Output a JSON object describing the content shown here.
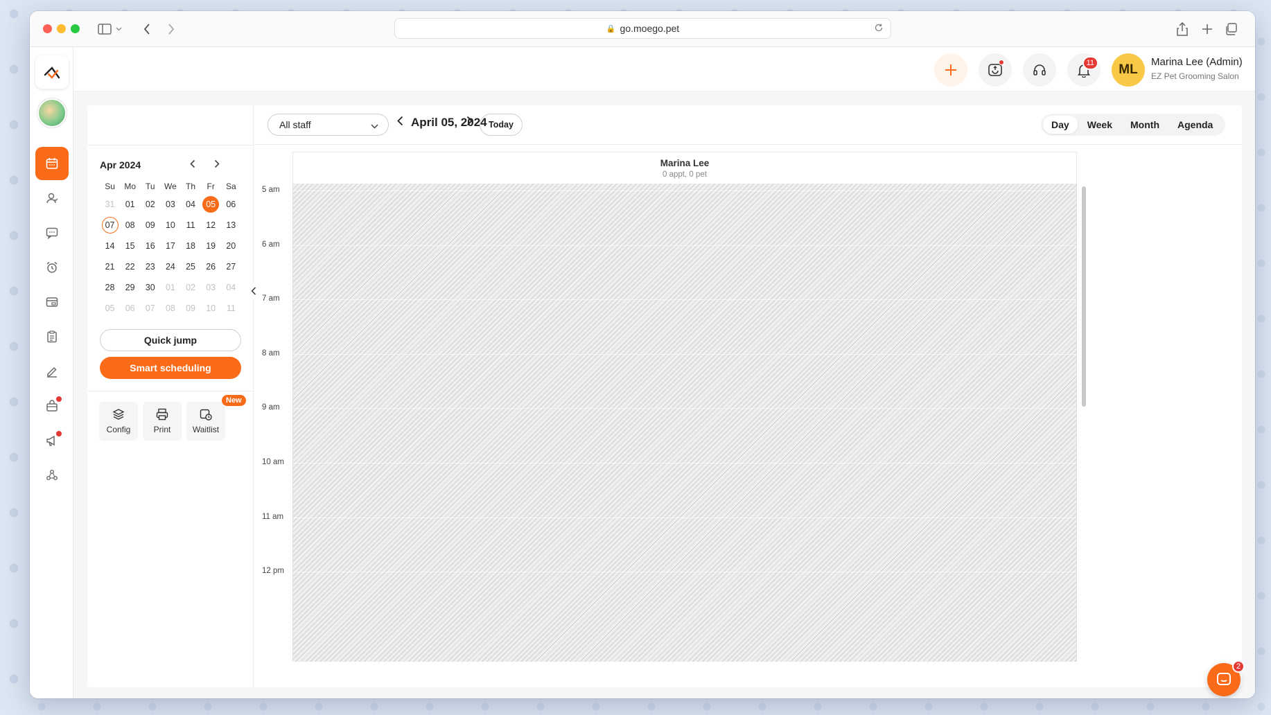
{
  "browser": {
    "url": "go.moego.pet"
  },
  "header": {
    "notification_count": "11",
    "user_initials": "ML",
    "user_name": "Marina Lee (Admin)",
    "business_name": "EZ Pet Grooming Salon"
  },
  "sidebar": {
    "items": [
      {
        "name": "calendar-icon",
        "active": true
      },
      {
        "name": "clients-icon"
      },
      {
        "name": "messages-icon"
      },
      {
        "name": "reminders-icon"
      },
      {
        "name": "payments-icon"
      },
      {
        "name": "reports-icon"
      },
      {
        "name": "edit-icon"
      },
      {
        "name": "retail-icon",
        "dot": true
      },
      {
        "name": "marketing-icon",
        "dot": true
      },
      {
        "name": "network-icon"
      }
    ]
  },
  "mini_calendar": {
    "month_label": "Apr 2024",
    "weekdays": [
      "Su",
      "Mo",
      "Tu",
      "We",
      "Th",
      "Fr",
      "Sa"
    ],
    "weeks": [
      [
        "31",
        "01",
        "02",
        "03",
        "04",
        "05",
        "06"
      ],
      [
        "07",
        "08",
        "09",
        "10",
        "11",
        "12",
        "13"
      ],
      [
        "14",
        "15",
        "16",
        "17",
        "18",
        "19",
        "20"
      ],
      [
        "21",
        "22",
        "23",
        "24",
        "25",
        "26",
        "27"
      ],
      [
        "28",
        "29",
        "30",
        "01",
        "02",
        "03",
        "04"
      ],
      [
        "05",
        "06",
        "07",
        "08",
        "09",
        "10",
        "11"
      ]
    ],
    "selected_date": "05",
    "today_date": "07"
  },
  "actions": {
    "quick_jump": "Quick jump",
    "smart_scheduling": "Smart scheduling"
  },
  "tools": {
    "config": "Config",
    "print": "Print",
    "waitlist": "Waitlist",
    "new_badge": "New"
  },
  "toolbar": {
    "staff_filter": "All staff",
    "date_label": "April 05, 2024",
    "today": "Today",
    "views": [
      "Day",
      "Week",
      "Month",
      "Agenda"
    ],
    "active_view": "Day"
  },
  "day_view": {
    "staff_name": "Marina Lee",
    "staff_summary": "0 appt, 0 pet",
    "hours": [
      "5 am",
      "6 am",
      "7 am",
      "8 am",
      "9 am",
      "10 am",
      "11 am",
      "12 pm"
    ]
  },
  "chat": {
    "badge": "2"
  },
  "colors": {
    "accent": "#f96b18",
    "badge_red": "#e53935",
    "avatar_yellow": "#f9c847"
  }
}
